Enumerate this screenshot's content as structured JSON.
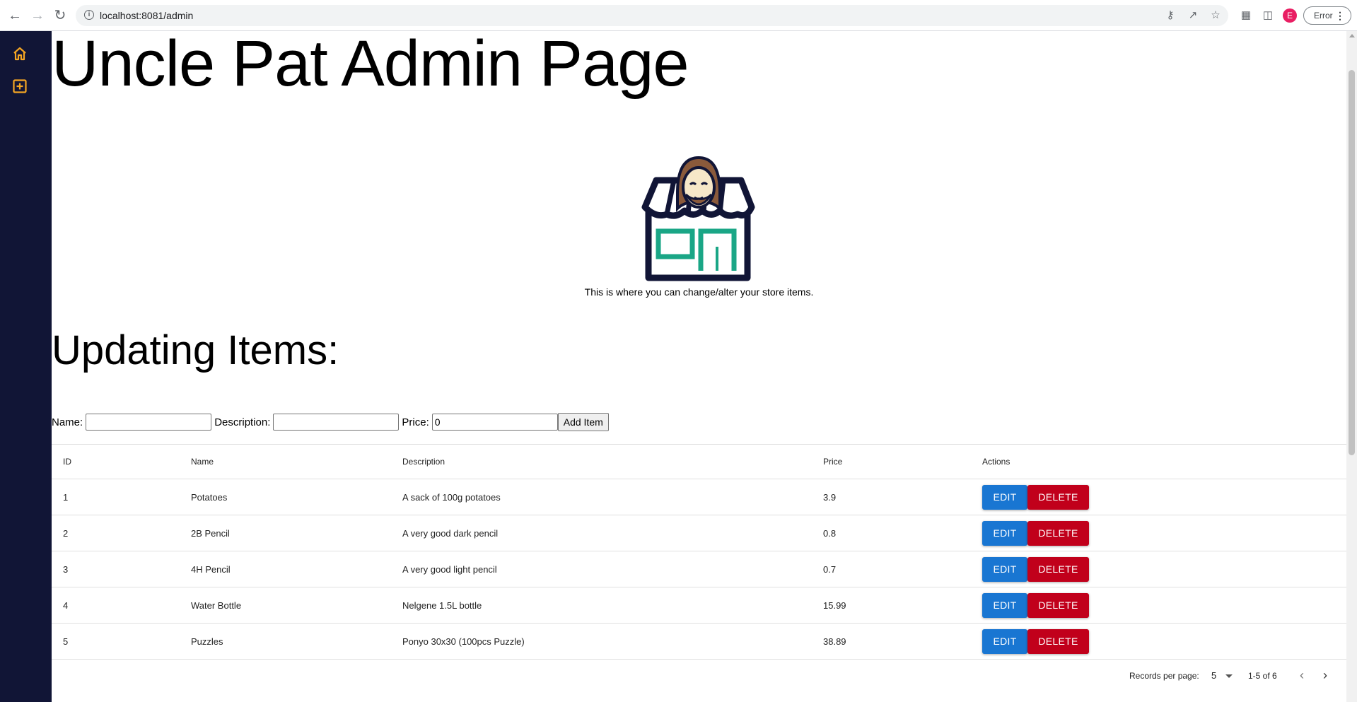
{
  "browser": {
    "url": "localhost:8081/admin",
    "profile_initial": "E",
    "error_chip": "Error"
  },
  "sidebar": {
    "items": [
      {
        "icon": "home-icon",
        "color": "#f5a623"
      },
      {
        "icon": "add-box-icon",
        "color": "#f5a623"
      }
    ]
  },
  "page": {
    "title": "Uncle Pat Admin Page",
    "intro": "This is where you can change/alter your store items.",
    "section_title": "Updating Items:"
  },
  "form": {
    "name_label": "Name:",
    "name_value": "",
    "description_label": "Description:",
    "description_value": "",
    "price_label": "Price:",
    "price_value": "0",
    "add_button": "Add Item"
  },
  "table": {
    "headers": {
      "id": "ID",
      "name": "Name",
      "description": "Description",
      "price": "Price",
      "actions": "Actions"
    },
    "edit_label": "EDIT",
    "delete_label": "DELETE",
    "rows": [
      {
        "id": "1",
        "name": "Potatoes",
        "description": "A sack of 100g potatoes",
        "price": "3.9"
      },
      {
        "id": "2",
        "name": "2B Pencil",
        "description": "A very good dark pencil",
        "price": "0.8"
      },
      {
        "id": "3",
        "name": "4H Pencil",
        "description": "A very good light pencil",
        "price": "0.7"
      },
      {
        "id": "4",
        "name": "Water Bottle",
        "description": "Nelgene 1.5L bottle",
        "price": "15.99"
      },
      {
        "id": "5",
        "name": "Puzzles",
        "description": "Ponyo 30x30 (100pcs Puzzle)",
        "price": "38.89"
      }
    ]
  },
  "pagination": {
    "records_label": "Records per page:",
    "records_per_page": "5",
    "range": "1-5 of 6"
  },
  "colors": {
    "sidebar_bg": "#111536",
    "edit": "#1976d2",
    "delete": "#c1001b",
    "accent": "#f5a623"
  }
}
